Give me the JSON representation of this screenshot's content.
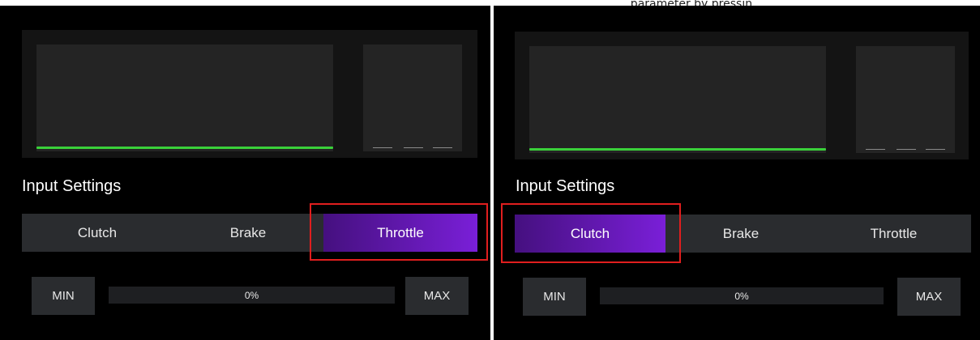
{
  "caption": "... parameter by pressin...",
  "panels": [
    {
      "section_title": "Input Settings",
      "tabs": [
        "Clutch",
        "Brake",
        "Throttle"
      ],
      "active_tab": "Throttle",
      "min_label": "MIN",
      "max_label": "MAX",
      "value_text": "0%",
      "highlight": "Throttle"
    },
    {
      "section_title": "Input Settings",
      "tabs": [
        "Clutch",
        "Brake",
        "Throttle"
      ],
      "active_tab": "Clutch",
      "min_label": "MIN",
      "max_label": "MAX",
      "value_text": "0%",
      "highlight": "Clutch"
    }
  ],
  "colors": {
    "accent_start": "#45107f",
    "accent_end": "#7a1fd8",
    "curve": "#3ad13a",
    "highlight": "#e01e1e"
  }
}
